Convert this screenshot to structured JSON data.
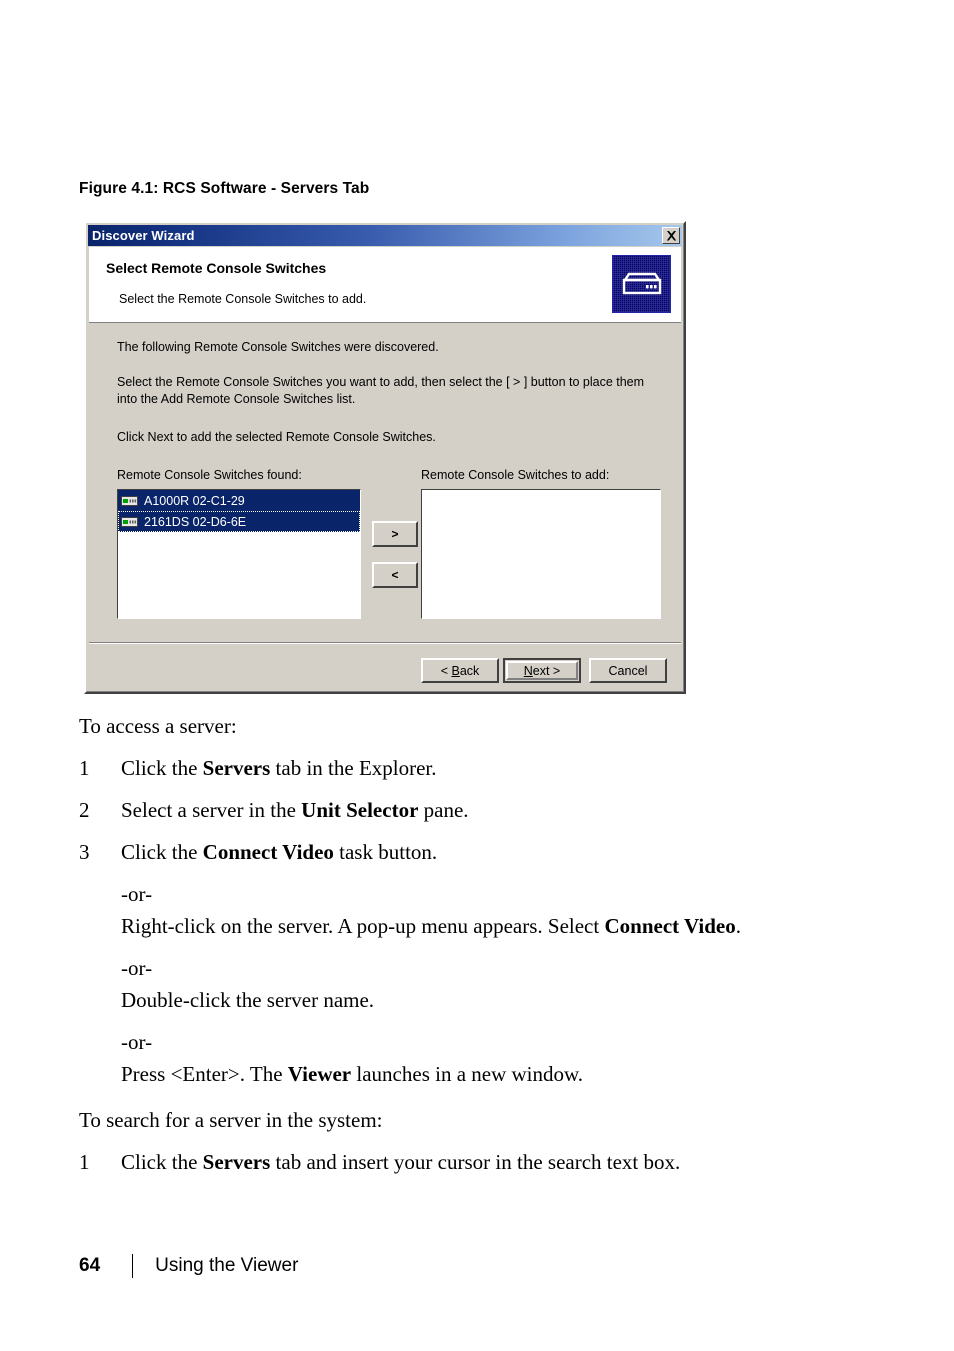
{
  "figure": {
    "caption": "Figure 4.1: RCS Software - Servers Tab"
  },
  "dialog": {
    "title": "Discover Wizard",
    "close_label": "✕",
    "header": {
      "title": "Select Remote Console Switches",
      "subtitle": "Select the Remote Console Switches to add.",
      "icon": "switch-appliance-icon"
    },
    "body": {
      "line1": "The following Remote Console Switches were discovered.",
      "line2": "Select the Remote Console Switches you want to add, then select the [ > ] button to place them into the Add Remote Console Switches list.",
      "line3": "Click Next to add the selected Remote Console Switches."
    },
    "lists": {
      "found_label": "Remote Console Switches found:",
      "toadd_label": "Remote Console Switches to add:",
      "found_items": [
        {
          "name": "A1000R 02-C1-29",
          "selected": true
        },
        {
          "name": "2161DS 02-D6-6E",
          "selected": true
        }
      ],
      "toadd_items": []
    },
    "transfer_buttons": {
      "add_label": ">",
      "remove_label": "<"
    },
    "nav_buttons": {
      "back_pre": "< ",
      "back_mnemonic": "B",
      "back_post": "ack",
      "next_mnemonic": "N",
      "next_post": "ext >",
      "cancel_label": "Cancel"
    },
    "colors": {
      "face": "#d4d0c8",
      "title_dark": "#0a246a",
      "title_light": "#a6c8ec",
      "selection": "#0a246a",
      "badge_bg": "#000066"
    }
  },
  "content": {
    "intro1": "To access a server:",
    "steps1": [
      {
        "num": "1",
        "pre": "Click the ",
        "bold": "Servers",
        "post": " tab in the Explorer."
      },
      {
        "num": "2",
        "pre": "Select a server in the ",
        "bold": "Unit Selector",
        "post": " pane."
      },
      {
        "num": "3",
        "pre": "Click the ",
        "bold": "Connect Video",
        "post": " task button."
      }
    ],
    "or_label": "-or-",
    "alt1_pre": "Right-click on the server. A pop-up menu appears. Select ",
    "alt1_bold": "Connect Video",
    "alt1_post": ".",
    "alt2": "Double-click the server name.",
    "alt3_pre": "Press <Enter>. The ",
    "alt3_bold": "Viewer",
    "alt3_post": " launches in a new window.",
    "intro2": "To search for a server in the system:",
    "steps2": [
      {
        "num": "1",
        "pre": "Click the ",
        "bold": "Servers",
        "post": " tab and insert your cursor in the search text box."
      }
    ]
  },
  "footer": {
    "page_number": "64",
    "title": "Using the Viewer"
  }
}
